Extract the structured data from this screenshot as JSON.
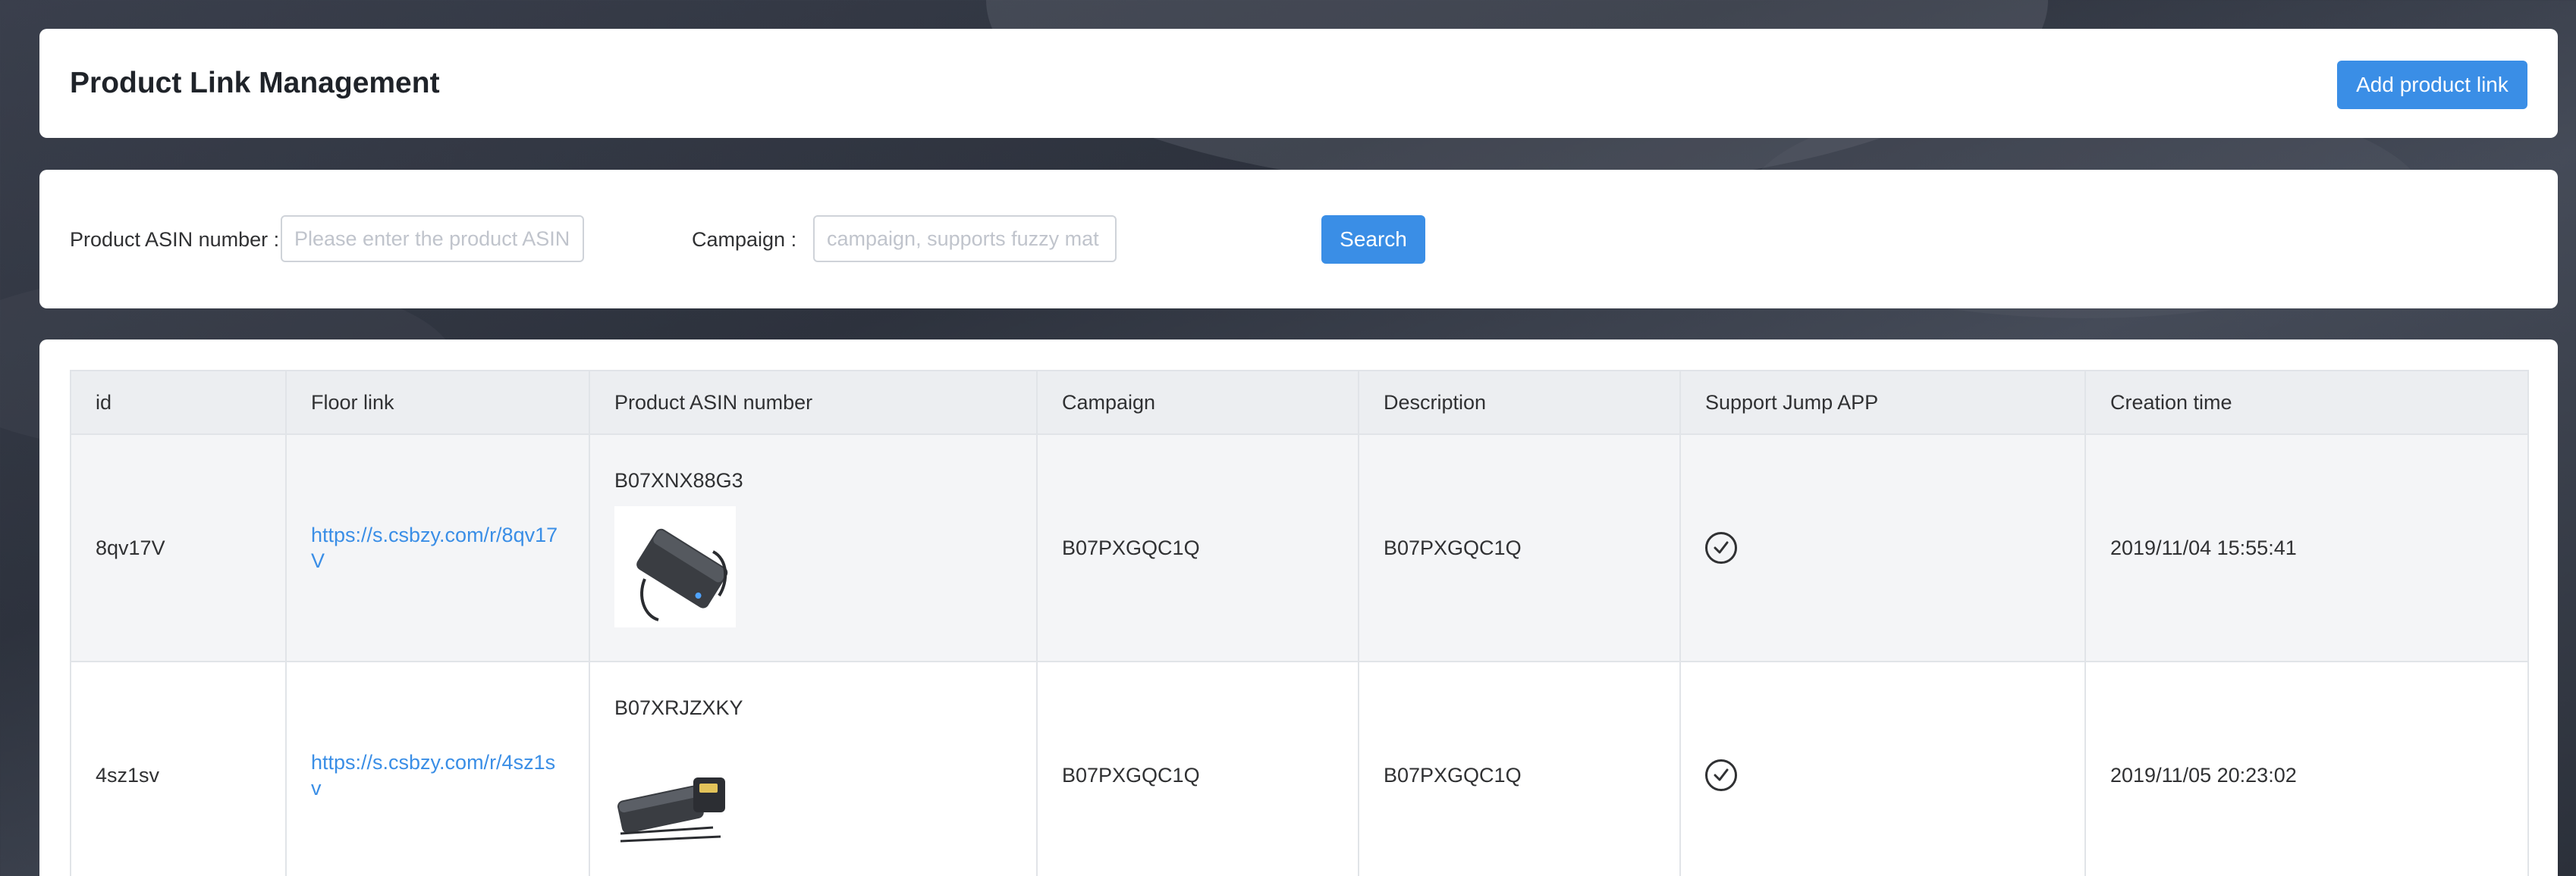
{
  "header": {
    "title": "Product Link Management",
    "add_button": "Add product link"
  },
  "search": {
    "asin_label": "Product ASIN number :",
    "asin_placeholder": "Please enter the product ASIN",
    "campaign_label": "Campaign :",
    "campaign_placeholder": "campaign, supports fuzzy mat",
    "search_button": "Search"
  },
  "table": {
    "columns": [
      "id",
      "Floor link",
      "Product ASIN number",
      "Campaign",
      "Description",
      "Support Jump APP",
      "Creation time"
    ],
    "rows": [
      {
        "id": "8qv17V",
        "floor_link": "https://s.csbzy.com/r/8qv17V",
        "asin": "B07XNX88G3",
        "image_icon": "power-bank-product-image",
        "campaign": "B07PXGQC1Q",
        "description": "B07PXGQC1Q",
        "support_jump_icon": "check-circle-icon",
        "created": "2019/11/04 15:55:41"
      },
      {
        "id": "4sz1sv",
        "floor_link": "https://s.csbzy.com/r/4sz1sv",
        "asin": "B07XRJZXKY",
        "image_icon": "power-bank-charger-product-image",
        "campaign": "B07PXGQC1Q",
        "description": "B07PXGQC1Q",
        "support_jump_icon": "check-circle-icon",
        "created": "2019/11/05 20:23:02"
      }
    ]
  },
  "colors": {
    "accent": "#3a8ee6",
    "link": "#3a8ee6",
    "header_bg": "#eceef1"
  }
}
